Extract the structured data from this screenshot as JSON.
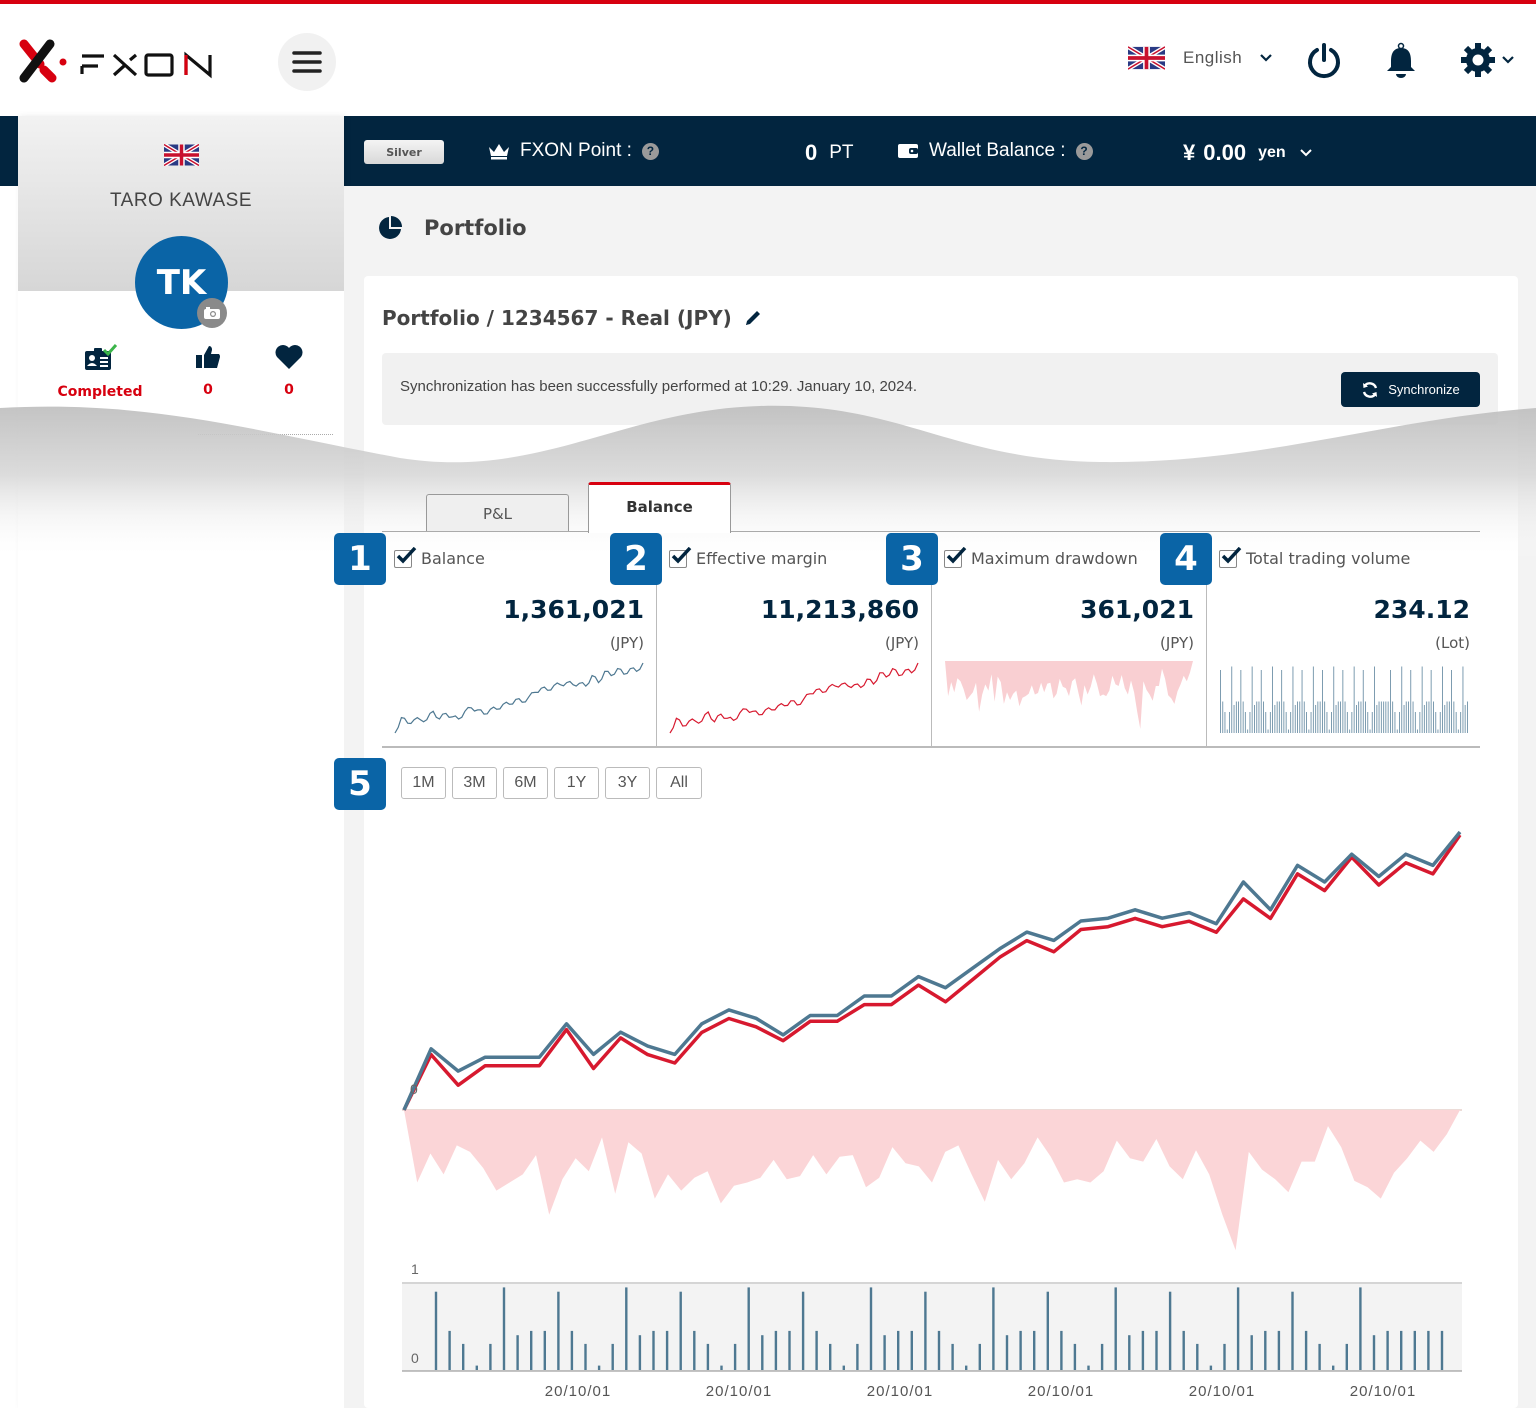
{
  "header": {
    "logo_text": "FXON",
    "language": "English",
    "icons": [
      "menu-icon",
      "uk-flag-icon",
      "chevron-down-icon",
      "power-icon",
      "bell-icon",
      "gear-icon"
    ]
  },
  "statusbar": {
    "rank": "Silver",
    "point_label": "FXON Point :",
    "point_value": "0",
    "point_unit": "PT",
    "wallet_label": "Wallet Balance :",
    "wallet_currency_symbol": "¥",
    "wallet_value": "0.00",
    "wallet_unit": "yen"
  },
  "sidebar": {
    "user_name": "TARO KAWASE",
    "initials": "TK",
    "stats": [
      {
        "icon": "id-card-check-icon",
        "value": "Completed"
      },
      {
        "icon": "thumbs-up-icon",
        "value": "0"
      },
      {
        "icon": "heart-icon",
        "value": "0"
      }
    ]
  },
  "page": {
    "title": "Portfolio",
    "card_title": "Portfolio / 1234567 - Real (JPY)",
    "sync_message": "Synchronization has been successfully performed at 10:29. January 10, 2024.",
    "sync_button": "Synchronize"
  },
  "tabs": [
    {
      "label": "P&L",
      "active": false
    },
    {
      "label": "Balance",
      "active": true
    }
  ],
  "metrics": [
    {
      "badge": "1",
      "label": "Balance",
      "checked": true,
      "value": "1,361,021",
      "unit": "(JPY)",
      "color": "#4e7891"
    },
    {
      "badge": "2",
      "label": "Effective margin",
      "checked": true,
      "value": "11,213,860",
      "unit": "(JPY)",
      "color": "#d7192f"
    },
    {
      "badge": "3",
      "label": "Maximum drawdown",
      "checked": true,
      "value": "361,021",
      "unit": "(JPY)",
      "color": "#f9cfd2"
    },
    {
      "badge": "4",
      "label": "Total trading volume",
      "checked": true,
      "value": "234.12",
      "unit": "(Lot)",
      "color": "#6f92a8"
    }
  ],
  "range": {
    "badge": "5",
    "buttons": [
      "1M",
      "3M",
      "6M",
      "1Y",
      "3Y",
      "All"
    ]
  },
  "colors": {
    "accent_red": "#d7000f",
    "navy": "#02253f",
    "badge_blue": "#0a64a6",
    "balance_line": "#4e7891",
    "margin_line": "#d7192f",
    "drawdown_fill": "#fbd5d7",
    "volume_bar": "#4e7891"
  },
  "chart_data": {
    "type": "line",
    "title": "",
    "series": [
      {
        "name": "Balance",
        "values": [
          0,
          22,
          14,
          19,
          19,
          19,
          31,
          20,
          28,
          23,
          20,
          31,
          36,
          33,
          27,
          34,
          34,
          41,
          41,
          48,
          44,
          51,
          58,
          64,
          61,
          68,
          69,
          72,
          69,
          71,
          67,
          82,
          72,
          88,
          82,
          92,
          84,
          92,
          88,
          100
        ]
      },
      {
        "name": "Effective margin",
        "values": [
          0,
          21,
          10,
          17,
          17,
          17,
          30,
          16,
          27,
          21,
          18,
          29,
          34,
          31,
          26,
          33,
          33,
          39,
          39,
          46,
          40,
          48,
          56,
          62,
          58,
          66,
          67,
          70,
          67,
          69,
          65,
          77,
          70,
          86,
          80,
          92,
          82,
          90,
          86,
          100
        ]
      },
      {
        "name": "Maximum drawdown",
        "values": [
          0,
          -45,
          -27,
          -40,
          -22,
          -26,
          -36,
          -50,
          -45,
          -40,
          -28,
          -65,
          -43,
          -30,
          -38,
          -17,
          -52,
          -20,
          -27,
          -55,
          -40,
          -50,
          -42,
          -38,
          -58,
          -47,
          -45,
          -42,
          -31,
          -43,
          -41,
          -28,
          -40,
          -29,
          -28,
          -48,
          -42,
          -23,
          -33,
          -35,
          -45,
          -26,
          -22,
          -40,
          -57,
          -31,
          -43,
          -33,
          -17,
          -29,
          -45,
          -43,
          -45,
          -38,
          -19,
          -30,
          -32,
          -18,
          -35,
          -43,
          -25,
          -40,
          -65,
          -87,
          -26,
          -37,
          -43,
          -51,
          -32,
          -32,
          -10,
          -23,
          -44,
          -48,
          -55,
          -39,
          -30,
          -19,
          -26,
          -15,
          0
        ]
      },
      {
        "name": "Total trading volume",
        "values": [
          0.9,
          0.45,
          0.3,
          0.05,
          0.3,
          0.95,
          0.4,
          0.45,
          0.45,
          0.9,
          0.45,
          0.3,
          0.05,
          0.3,
          0.95,
          0.4,
          0.45,
          0.45,
          0.9,
          0.45,
          0.3,
          0.05,
          0.3,
          0.95,
          0.4,
          0.45,
          0.45,
          0.9,
          0.45,
          0.3,
          0.05,
          0.3,
          0.95,
          0.4,
          0.45,
          0.45,
          0.9,
          0.45,
          0.3,
          0.05,
          0.3,
          0.95,
          0.4,
          0.45,
          0.45,
          0.9,
          0.45,
          0.3,
          0.05,
          0.3,
          0.95,
          0.4,
          0.45,
          0.45,
          0.9,
          0.45,
          0.3,
          0.05,
          0.3,
          0.95,
          0.4,
          0.45,
          0.45,
          0.9,
          0.45,
          0.3,
          0.05,
          0.3,
          0.95,
          0.4,
          0.45,
          0.45,
          0.45,
          0.45,
          0.45
        ]
      }
    ],
    "y_tick_labels": {
      "balance_axis": [
        "0"
      ],
      "volume_axis": [
        "0",
        "1"
      ]
    },
    "volume_ylim": [
      0,
      1
    ],
    "x_tick_labels": [
      "20/10/01",
      "20/10/01",
      "20/10/01",
      "20/10/01",
      "20/10/01",
      "20/10/01"
    ],
    "grid": false,
    "legend": "none"
  }
}
